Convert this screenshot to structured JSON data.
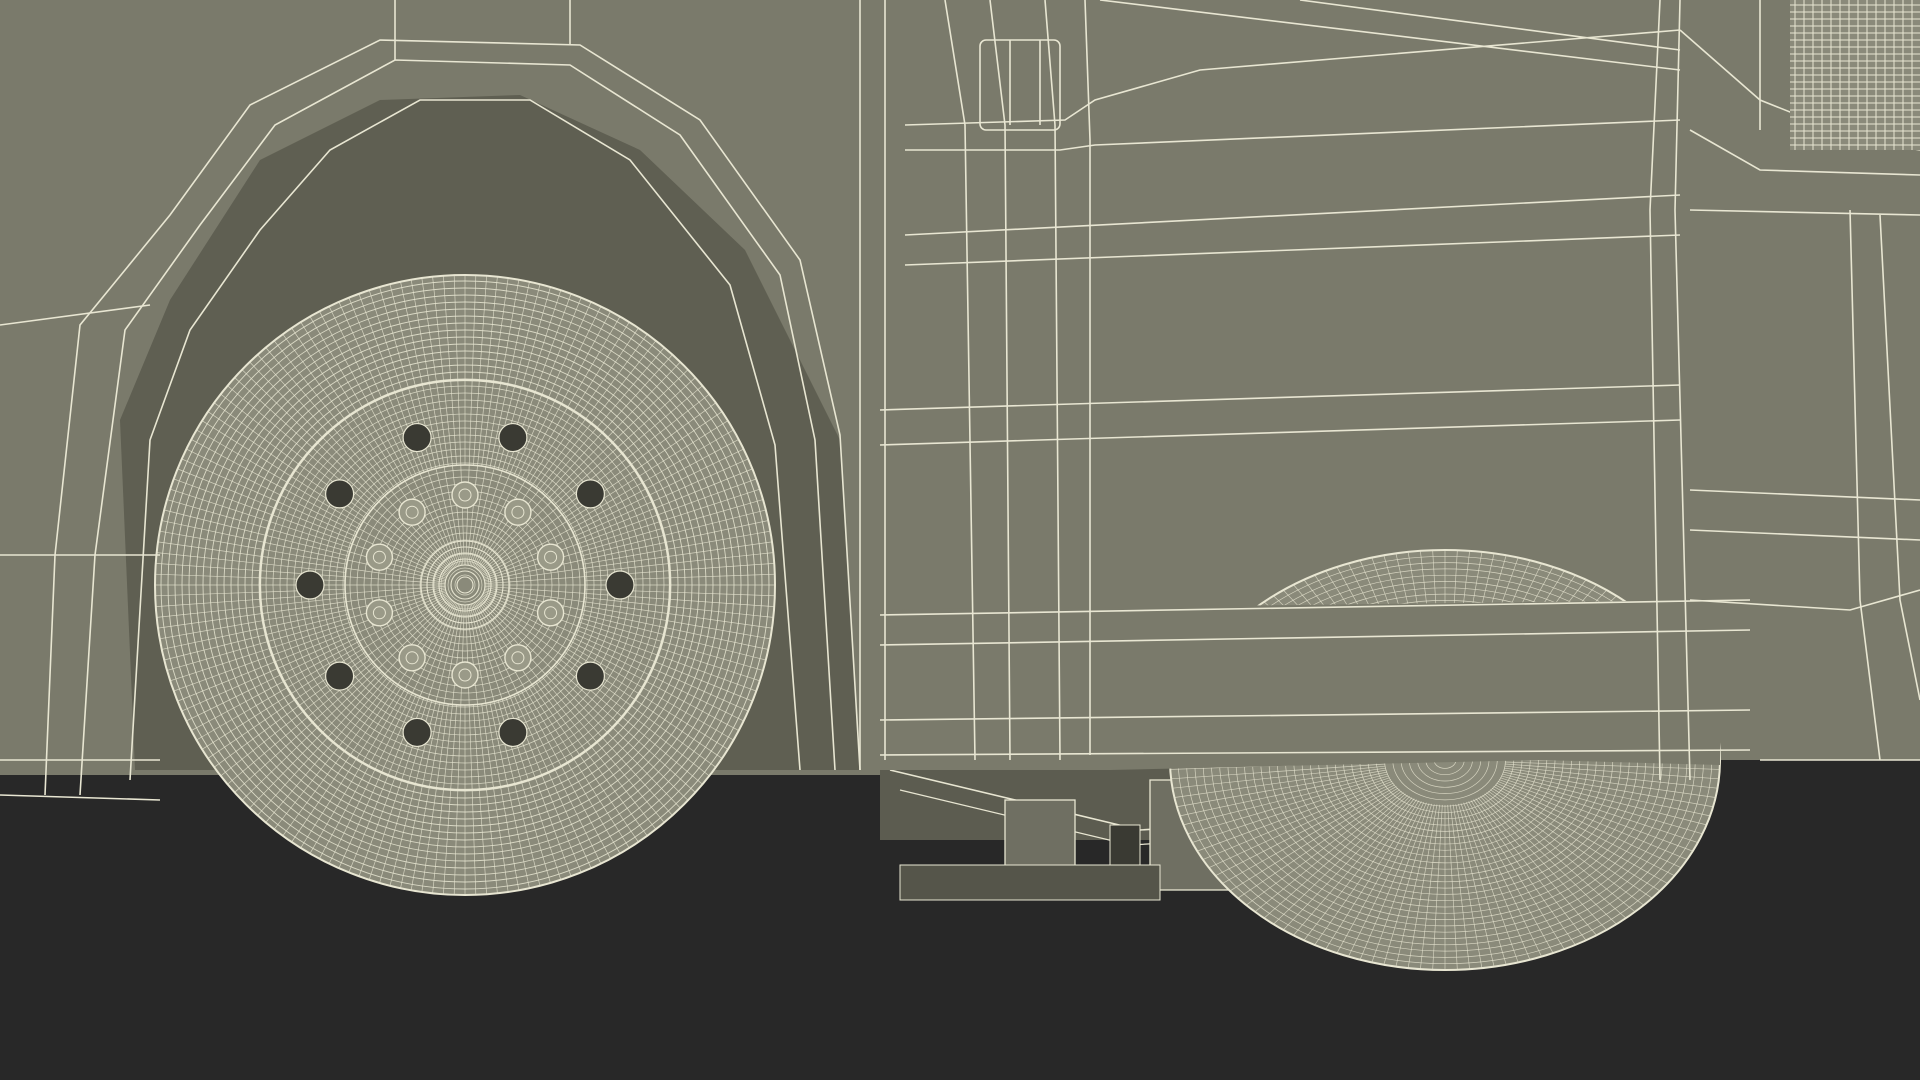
{
  "scene": {
    "subject": "wireframe-render-vehicle-wheel",
    "colors": {
      "ground": "#282828",
      "body_fill": "#7a7a6b",
      "body_shadow": "#5f5f52",
      "wire": "#e8e6d2",
      "wire_dim": "#c9c7b2",
      "dark": "#3a3a33"
    }
  }
}
